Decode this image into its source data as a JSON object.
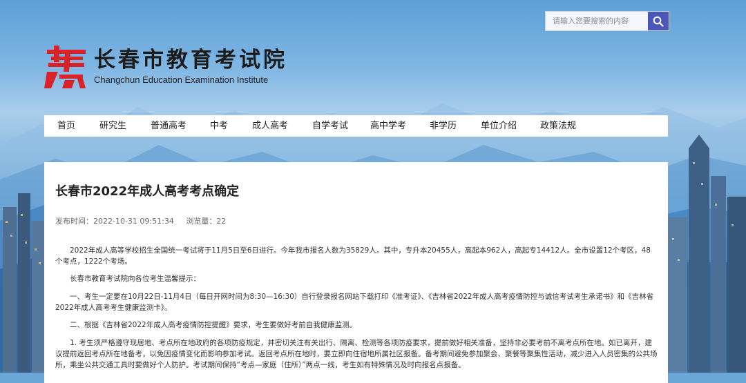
{
  "search": {
    "placeholder": "请输入您要搜索的内容"
  },
  "logo": {
    "cn": "长春市教育考试院",
    "en": "Changchun Education Examination Institute"
  },
  "nav": {
    "items": [
      "首页",
      "研究生",
      "普通高考",
      "中考",
      "成人高考",
      "自学考试",
      "高中学考",
      "非学历",
      "单位介绍",
      "政策法规"
    ]
  },
  "article": {
    "title": "长春市2022年成人高考考点确定",
    "publish_time": "发布时间：2022-10-31 09:51:34",
    "views": "浏览量：22",
    "paragraphs": [
      "2022年成人高等学校招生全国统一考试将于11月5日至6日进行。今年我市报名人数为35829人。其中，专升本20455人，高起本962人，高起专14412人。全市设置12个考区，48个考点，1222个考场。",
      "长春市教育考试院向各位考生温馨提示：",
      "一、考生一定要在10月22日-11月4日（每日开网时间为8:30—16:30）自行登录报名网站下载打印《准考证》、《吉林省2022年成人高考疫情防控与诚信考试考生承诺书》和《吉林省2022年成人高考考生健康监测卡》。",
      "二、根据《吉林省2022年成人高考疫情防控提醒》要求，考生要做好考前自我健康监测。",
      "1. 考生须严格遵守现居地、考点所在地政府的各项防疫规定，并密切关注有关出行、隔离、检测等各项防疫要求，提前做好相关准备，坚持非必要考前不离考点所在地。如已离开，建议提前返回考点所在地备考，以免因疫情变化而影响参加考试。返回考点所在地时，要立即向住宿地所属社区报备。备考期间避免参加聚会、聚餐等聚集性活动，减少进入人员密集的公共场所，乘坐公共交通工具时要做好个人防护。考试期间保持“考点—家庭（住所）”两点一线，考生如有特殊情况及时向报名点报备。"
    ]
  }
}
